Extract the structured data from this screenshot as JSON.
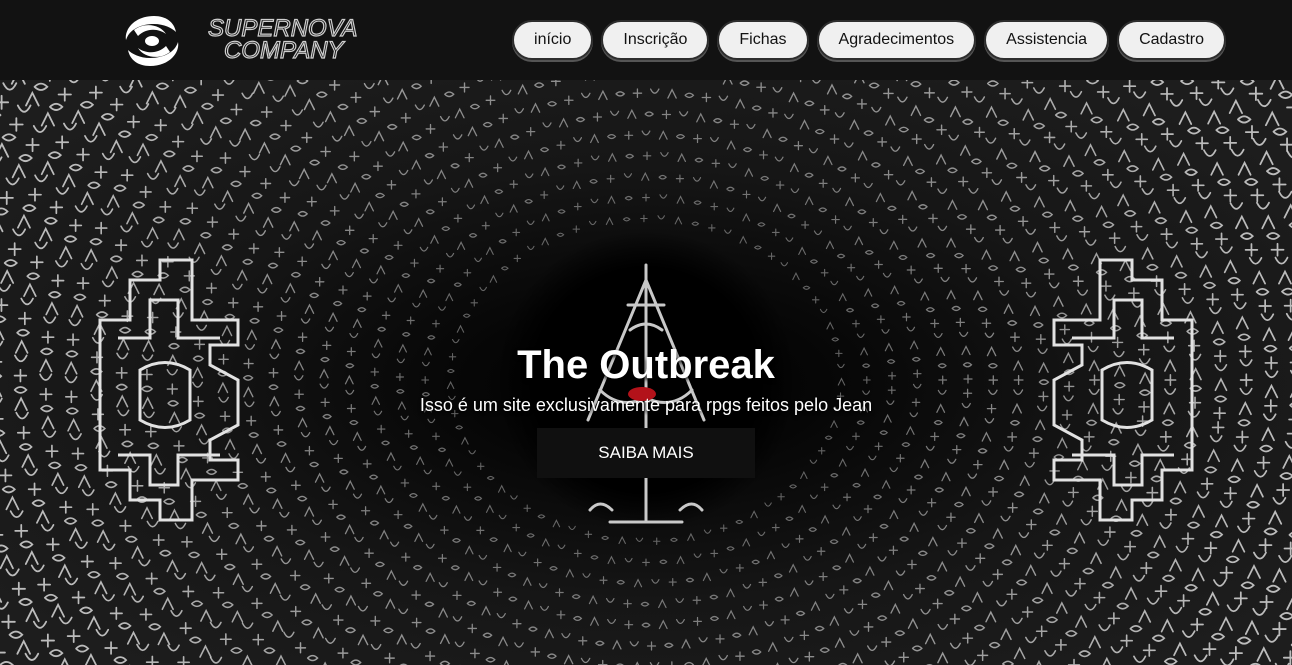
{
  "brand": {
    "name_line1": "SUPERNOVA",
    "name_line2": "COMPANY",
    "icon": "spiral-galaxy-icon"
  },
  "nav": {
    "items": [
      {
        "label": "início"
      },
      {
        "label": "Inscrição"
      },
      {
        "label": "Fichas"
      },
      {
        "label": "Agradecimentos"
      },
      {
        "label": "Assistencia"
      },
      {
        "label": "Cadastro"
      }
    ]
  },
  "hero": {
    "title": "The Outbreak",
    "subtitle": "Isso é um site exclusivamente para rpgs feitos pelo Jean",
    "cta_label": "SAIBA MAIS",
    "background_image": "occult-glyph-tunnel"
  },
  "colors": {
    "header_bg": "#121212",
    "nav_button_bg": "#f0f0f0",
    "cta_bg": "#101010",
    "accent_red": "#b3121a"
  }
}
